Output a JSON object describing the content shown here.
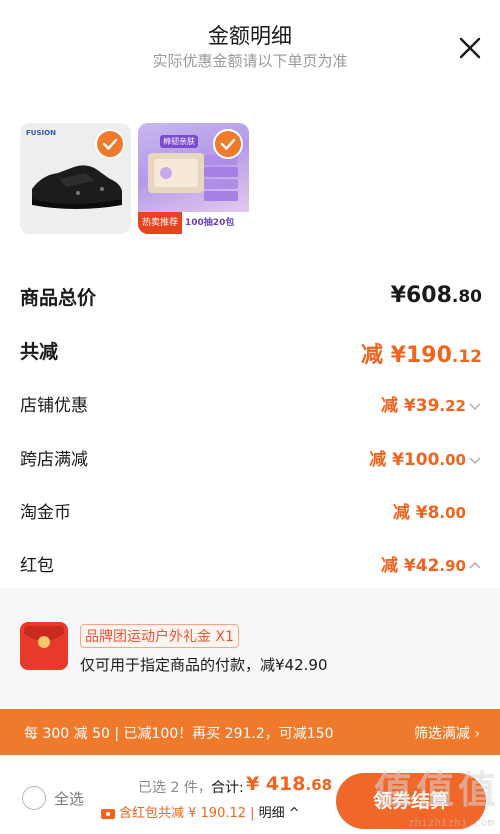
{
  "header": {
    "title": "金额明细",
    "subtitle": "实际优惠金额请以下单页为准",
    "close_icon": "close-icon"
  },
  "products": [
    {
      "name": "shoe",
      "brand_label": "FUSION",
      "checked": true
    },
    {
      "name": "tissue",
      "pack_label": "棉韧亲肤",
      "promo_hot": "热卖推荐",
      "promo_spec": "100抽20包",
      "checked": true
    }
  ],
  "summary": {
    "total_label": "商品总价",
    "total_main": "¥608",
    "total_cents": ".80",
    "reduce_label": "共减",
    "reduce_main": "减 ¥190",
    "reduce_cents": ".12"
  },
  "discounts": [
    {
      "label": "店铺优惠",
      "main": "减 ¥39",
      "cents": ".22",
      "chevron": "chevron-down-icon"
    },
    {
      "label": "跨店满减",
      "main": "减 ¥100",
      "cents": ".00",
      "chevron": "chevron-down-icon"
    },
    {
      "label": "淘金币",
      "main": "减 ¥8",
      "cents": ".00"
    },
    {
      "label": "红包",
      "main": "减 ¥42",
      "cents": ".90",
      "chevron": "chevron-up-icon"
    }
  ],
  "coupon": {
    "icon": "red-packet-icon",
    "title": "品牌团运动户外礼金 X1",
    "desc": "仅可用于指定商品的付款，减¥42.90"
  },
  "deal_bar": {
    "text": "每 300 减 50 | 已减100！再买 291.2，可减150",
    "filter": "筛选满减 ›"
  },
  "footer": {
    "select_all": "全选",
    "selected_count": "已选 2 件，",
    "sum_label": "合计:",
    "sum_main": "¥ 418",
    "sum_cents": ".68",
    "redpacket_text": "含红包共减 ¥ 190.12 | ",
    "detail_link": "明细 ^",
    "checkout": "领券结算",
    "watermark": "zhizhizhi.com"
  },
  "colors": {
    "accent": "#f0641e",
    "deal_bar": "#f07a2c",
    "checkout": "#f0672a"
  }
}
